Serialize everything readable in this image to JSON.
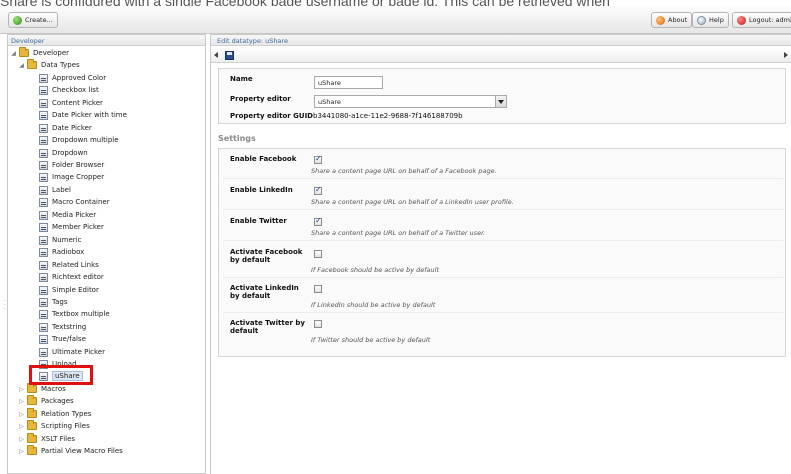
{
  "background_text": "Share is configured with a single Facebook page username or page id. This can be retrieved when",
  "toolbar": {
    "create_label": "Create...",
    "about_label": "About",
    "help_label": "Help",
    "logout_label": "Logout: admin"
  },
  "tree": {
    "header": "Developer",
    "root": "Developer",
    "data_types_folder": "Data Types",
    "data_types": [
      "Approved Color",
      "Checkbox list",
      "Content Picker",
      "Date Picker with time",
      "Date Picker",
      "Dropdown multiple",
      "Dropdown",
      "Folder Browser",
      "Image Cropper",
      "Label",
      "Macro Container",
      "Media Picker",
      "Member Picker",
      "Numeric",
      "Radiobox",
      "Related Links",
      "Richtext editor",
      "Simple Editor",
      "Tags",
      "Textbox multiple",
      "Textstring",
      "True/false",
      "Ultimate Picker",
      "Upload",
      "uShare"
    ],
    "folders": [
      "Macros",
      "Packages",
      "Relation Types",
      "Scripting Files",
      "XSLT Files",
      "Partial View Macro Files"
    ],
    "selected": "uShare"
  },
  "editor": {
    "header": "Edit datatype: uShare",
    "name_label": "Name",
    "name_value": "uShare",
    "property_editor_label": "Property editor",
    "property_editor_value": "uShare",
    "guid_label": "Property editor GUID",
    "guid_value": "b3441080-a1ce-11e2-9688-7f146188709b",
    "settings_title": "Settings",
    "settings": [
      {
        "label": "Enable Facebook",
        "checked": true,
        "description": "Share a content page URL on behalf of a Facebook page."
      },
      {
        "label": "Enable LinkedIn",
        "checked": true,
        "description": "Share a content page URL on behalf of a LinkedIn user profile."
      },
      {
        "label": "Enable Twitter",
        "checked": true,
        "description": "Share a content page URL on behalf of a Twitter user."
      },
      {
        "label": "Activate Facebook by default",
        "checked": false,
        "description": "If Facebook should be active by default"
      },
      {
        "label": "Activate LinkedIn by default",
        "checked": false,
        "description": "If LinkedIn should be active by default"
      },
      {
        "label": "Activate Twitter by default",
        "checked": false,
        "description": "If Twitter should be active by default"
      }
    ]
  },
  "colors": {
    "highlight": "#e01010",
    "header_text": "#3a6aa0",
    "folder": "#e8b63a"
  }
}
